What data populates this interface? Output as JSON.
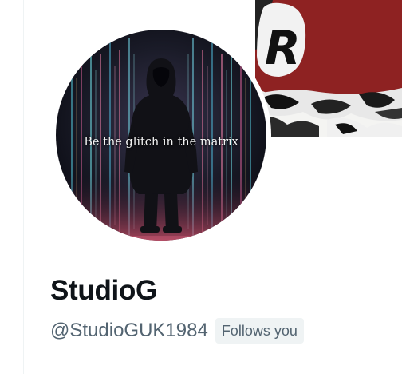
{
  "profile": {
    "display_name": "StudioG",
    "handle": "@StudioGUK1984",
    "follows_badge": "Follows you",
    "avatar_caption": "Be the glitch in the matrix"
  },
  "banner": {
    "letter": "R"
  },
  "colors": {
    "name_text": "#0f1419",
    "secondary_text": "#536471",
    "badge_background": "#eff3f4",
    "banner_red": "#8e2222"
  }
}
